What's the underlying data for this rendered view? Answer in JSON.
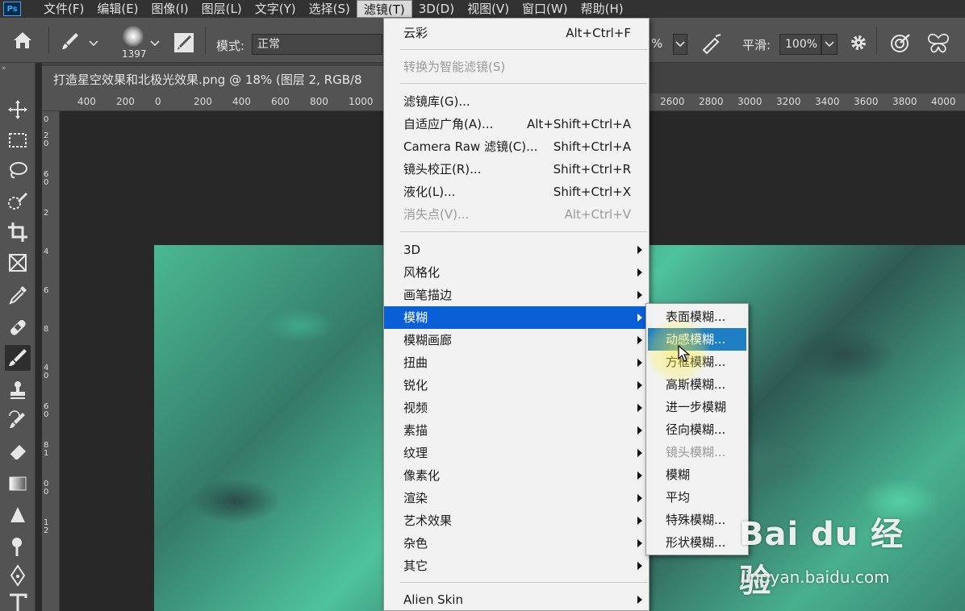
{
  "menubar": {
    "items": [
      "文件(F)",
      "编辑(E)",
      "图像(I)",
      "图层(L)",
      "文字(Y)",
      "选择(S)",
      "滤镜(T)",
      "3D(D)",
      "视图(V)",
      "窗口(W)",
      "帮助(H)"
    ],
    "active_index": 6,
    "logo": "Ps"
  },
  "options": {
    "brush_size": "1397",
    "mode_label": "模式:",
    "mode_value": "正常",
    "opacity_fragment": "%",
    "smooth_label": "平滑:",
    "smooth_value": "100%"
  },
  "document": {
    "tab_title": "打造星空效果和北极光效果.png @ 18% (图层 2, RGB/8"
  },
  "ruler": {
    "h_left": [
      "400",
      "200",
      "0",
      "200",
      "400",
      "600",
      "800",
      "1000"
    ],
    "h_right": [
      "2600",
      "2800",
      "3000",
      "3200",
      "3400",
      "3600",
      "3800",
      "4000"
    ],
    "v_labels": [
      "0",
      "2",
      "0",
      "6",
      "0",
      "2",
      "4",
      "6",
      "8",
      "4",
      "0",
      "6",
      "0",
      "8",
      "1",
      "0",
      "0",
      "1",
      "2"
    ]
  },
  "filter_menu": {
    "items": [
      {
        "label": "云彩",
        "shortcut": "Alt+Ctrl+F"
      },
      {
        "label": "转换为智能滤镜(S)",
        "disabled": true
      },
      {
        "label": "滤镜库(G)..."
      },
      {
        "label": "自适应广角(A)...",
        "shortcut": "Alt+Shift+Ctrl+A"
      },
      {
        "label": "Camera Raw 滤镜(C)...",
        "shortcut": "Shift+Ctrl+A"
      },
      {
        "label": "镜头校正(R)...",
        "shortcut": "Shift+Ctrl+R"
      },
      {
        "label": "液化(L)...",
        "shortcut": "Shift+Ctrl+X"
      },
      {
        "label": "消失点(V)...",
        "shortcut": "Alt+Ctrl+V",
        "disabled": true
      },
      {
        "label": "3D",
        "submenu": true
      },
      {
        "label": "风格化",
        "submenu": true
      },
      {
        "label": "画笔描边",
        "submenu": true
      },
      {
        "label": "模糊",
        "submenu": true,
        "highlighted": true
      },
      {
        "label": "模糊画廊",
        "submenu": true
      },
      {
        "label": "扭曲",
        "submenu": true
      },
      {
        "label": "锐化",
        "submenu": true
      },
      {
        "label": "视频",
        "submenu": true
      },
      {
        "label": "素描",
        "submenu": true
      },
      {
        "label": "纹理",
        "submenu": true
      },
      {
        "label": "像素化",
        "submenu": true
      },
      {
        "label": "渲染",
        "submenu": true
      },
      {
        "label": "艺术效果",
        "submenu": true
      },
      {
        "label": "杂色",
        "submenu": true
      },
      {
        "label": "其它",
        "submenu": true
      },
      {
        "label": "Alien Skin",
        "submenu": true
      }
    ]
  },
  "blur_submenu": {
    "items": [
      {
        "label": "表面模糊..."
      },
      {
        "label": "动感模糊...",
        "highlighted": true
      },
      {
        "label": "方框模糊..."
      },
      {
        "label": "高斯模糊..."
      },
      {
        "label": "进一步模糊"
      },
      {
        "label": "径向模糊..."
      },
      {
        "label": "镜头模糊...",
        "disabled": true
      },
      {
        "label": "模糊"
      },
      {
        "label": "平均"
      },
      {
        "label": "特殊模糊..."
      },
      {
        "label": "形状模糊..."
      }
    ]
  },
  "watermark": {
    "brand": "Bai du 经验",
    "url": "jingyan.baidu.com"
  },
  "colors": {
    "menu_highlight": "#0a5fd6",
    "submenu_highlight": "#1f7fc4",
    "canvas_teal": "#4ab892"
  }
}
